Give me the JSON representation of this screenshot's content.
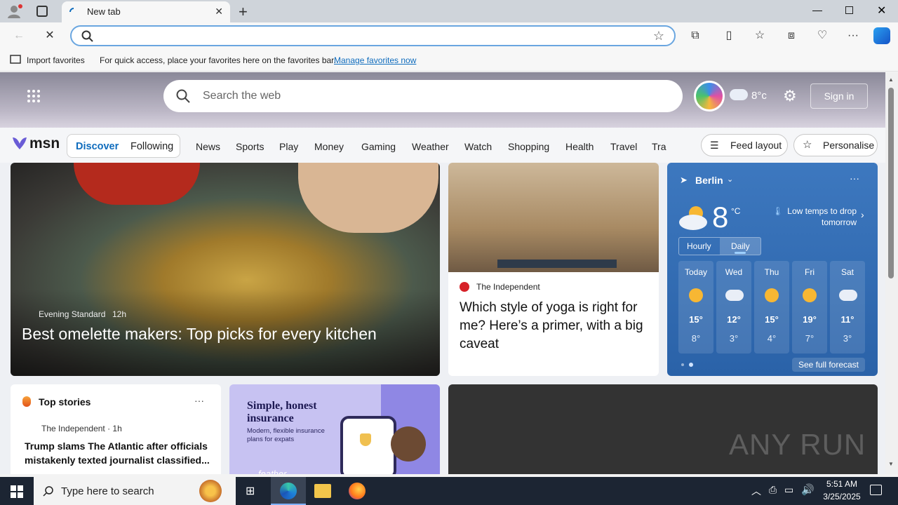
{
  "browser": {
    "tab_title": "New tab",
    "fav_import": "Import favorites",
    "fav_hint": "For quick access, place your favorites here on the favorites bar.",
    "fav_manage": "Manage favorites now"
  },
  "msn": {
    "search_placeholder": "Search the web",
    "header_weather": "8°c",
    "sign_in": "Sign in",
    "logo_text": "msn",
    "tabs": [
      "Discover",
      "Following"
    ],
    "nav": [
      "News",
      "Sports",
      "Play",
      "Money",
      "Gaming",
      "Weather",
      "Watch",
      "Shopping",
      "Health",
      "Travel",
      "Tra"
    ],
    "feed_layout": "Feed layout",
    "personalise": "Personalise"
  },
  "main_story": {
    "source": "Evening Standard",
    "time": "12h",
    "title": "Best omelette makers: Top picks for every kitchen"
  },
  "yoga_story": {
    "source": "The Independent",
    "title": "Which style of yoga is right for me? Here’s a primer, with a big caveat"
  },
  "weather": {
    "city": "Berlin",
    "temp": "8",
    "unit": "°C",
    "alert": "Low temps to drop tomorrow",
    "tab_hourly": "Hourly",
    "tab_daily": "Daily",
    "days": [
      {
        "day": "Today",
        "hi": "15°",
        "lo": "8°"
      },
      {
        "day": "Wed",
        "hi": "12°",
        "lo": "3°"
      },
      {
        "day": "Thu",
        "hi": "15°",
        "lo": "4°"
      },
      {
        "day": "Fri",
        "hi": "19°",
        "lo": "7°"
      },
      {
        "day": "Sat",
        "hi": "11°",
        "lo": "3°"
      }
    ],
    "full_forecast": "See full forecast"
  },
  "top_stories": {
    "heading": "Top stories",
    "source": "The Independent · 1h",
    "title": "Trump slams The Atlantic after officials mistakenly texted journalist classified..."
  },
  "ad": {
    "headline": "Simple, honest insurance",
    "body": "Modern, flexible insurance plans for expats",
    "brand": "feather"
  },
  "watermark": "ANY RUN",
  "taskbar": {
    "search_placeholder": "Type here to search",
    "time": "5:51 AM",
    "date": "3/25/2025"
  },
  "colors": {
    "accent": "#0f6cbd",
    "weather_bg": "#2f6cb1"
  }
}
